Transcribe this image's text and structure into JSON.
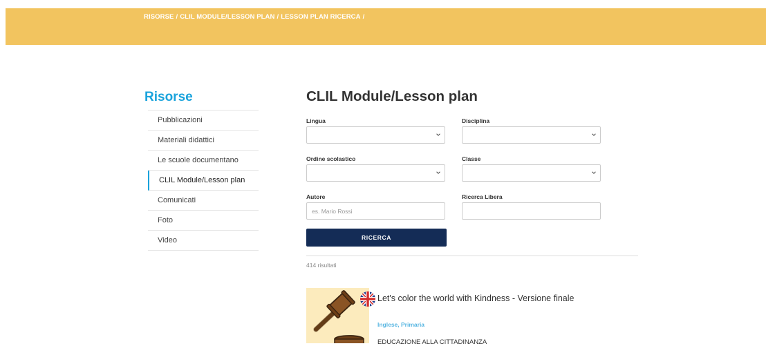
{
  "breadcrumb": {
    "items": [
      "RISORSE",
      "CLIL MODULE/LESSON PLAN",
      "LESSON PLAN RICERCA"
    ],
    "separator": "/"
  },
  "sidebar": {
    "title": "Risorse",
    "items": [
      {
        "label": "Pubblicazioni"
      },
      {
        "label": "Materiali didattici"
      },
      {
        "label": "Le scuole documentano"
      },
      {
        "label": "CLIL Module/Lesson plan"
      },
      {
        "label": "Comunicati"
      },
      {
        "label": "Foto"
      },
      {
        "label": "Video"
      }
    ],
    "active_index": 3
  },
  "main": {
    "title": "CLIL Module/Lesson plan",
    "form": {
      "lingua": {
        "label": "Lingua",
        "value": ""
      },
      "disciplina": {
        "label": "Disciplina",
        "value": ""
      },
      "ordine": {
        "label": "Ordine scolastico",
        "value": ""
      },
      "classe": {
        "label": "Classe",
        "value": ""
      },
      "autore": {
        "label": "Autore",
        "placeholder": "es. Mario Rossi",
        "value": ""
      },
      "ricerca_libera": {
        "label": "Ricerca Libera",
        "placeholder": "",
        "value": ""
      },
      "submit_label": "RICERCA"
    },
    "results_count": "414 risultati",
    "results": [
      {
        "title": "Let's color the world with Kindness - Versione finale",
        "tags": "Inglese, Primaria",
        "subject": "EDUCAZIONE ALLA CITTADINANZA",
        "flag_icon": "uk-flag-icon",
        "thumbnail_icon": "gavel-icon"
      }
    ]
  },
  "colors": {
    "banner": "#f2c45f",
    "accent": "#1aa3dc",
    "button": "#142c56",
    "tags": "#5ab7e2",
    "thumbnail_bg": "#fcebbd"
  }
}
